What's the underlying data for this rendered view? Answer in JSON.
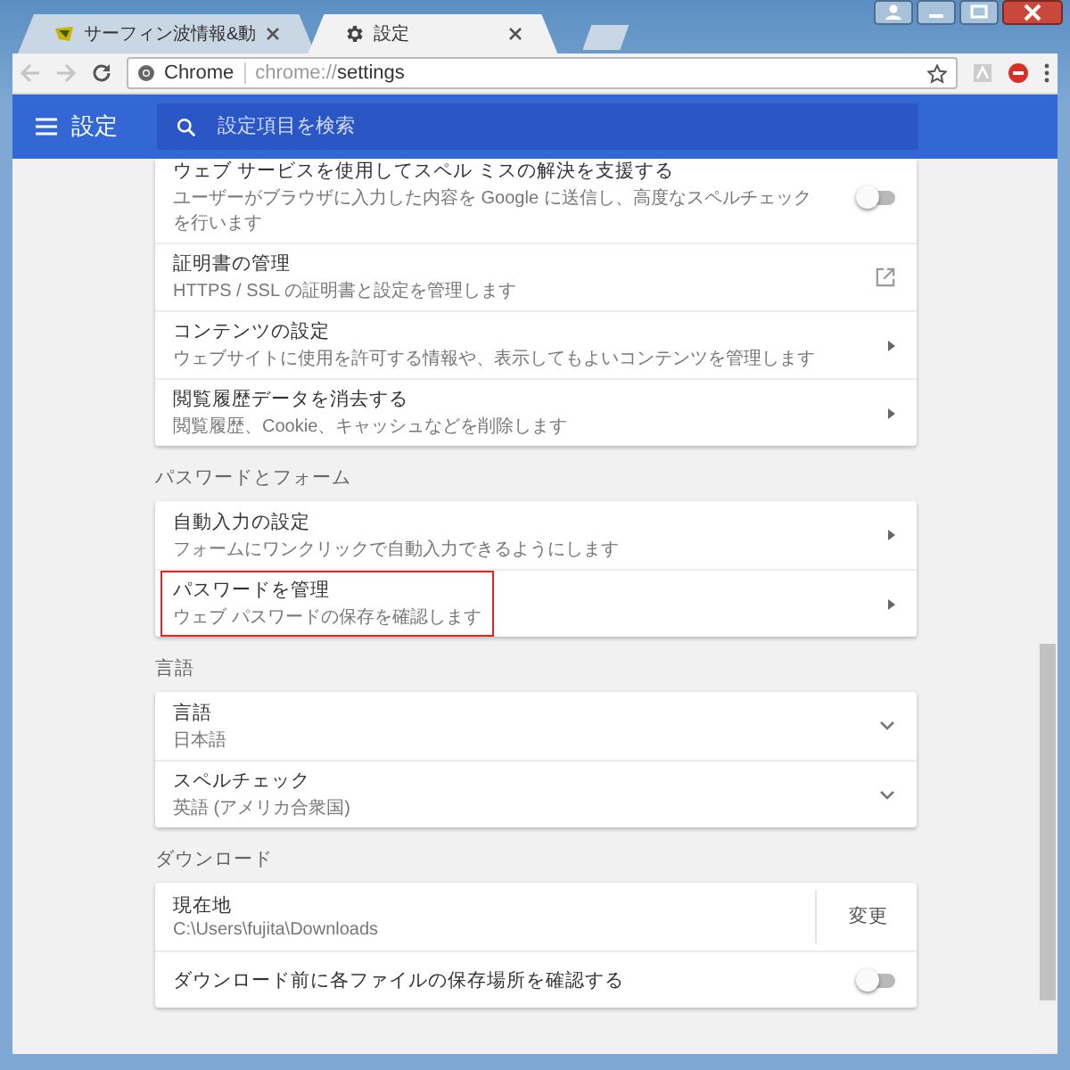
{
  "tabs": [
    {
      "title": "サーフィン波情報&動",
      "kind": "site",
      "selected": false
    },
    {
      "title": "設定",
      "kind": "settings",
      "selected": true
    }
  ],
  "toolbar": {
    "back": {
      "disabled": true
    },
    "forward": {
      "disabled": true
    },
    "omnibox": {
      "site_label": "Chrome",
      "url_scheme": "chrome://",
      "url_path": "settings",
      "bookmarked": false
    }
  },
  "header": {
    "title": "設定",
    "search": {
      "placeholder": "設定項目を検索"
    }
  },
  "sections": [
    {
      "items": [
        {
          "title": "ウェブ サービスを使用してスペル ミスの解決を支援する",
          "subtitle": "ユーザーがブラウザに入力した内容を Google に送信し、高度なスペルチェックを行います",
          "kind": "toggle",
          "on": false,
          "highlighted": false
        },
        {
          "title": "証明書の管理",
          "subtitle": "HTTPS / SSL の証明書と設定を管理します",
          "kind": "external",
          "highlighted": false
        },
        {
          "title": "コンテンツの設定",
          "subtitle": "ウェブサイトに使用を許可する情報や、表示してもよいコンテンツを管理します",
          "kind": "arrow",
          "highlighted": false
        },
        {
          "title": "閲覧履歴データを消去する",
          "subtitle": "閲覧履歴、Cookie、キャッシュなどを削除します",
          "kind": "arrow",
          "highlighted": false
        }
      ]
    },
    {
      "heading": "パスワードとフォーム",
      "items": [
        {
          "title": "自動入力の設定",
          "subtitle": "フォームにワンクリックで自動入力できるようにします",
          "kind": "arrow",
          "highlighted": false
        },
        {
          "title": "パスワードを管理",
          "subtitle": "ウェブ パスワードの保存を確認します",
          "kind": "arrow",
          "highlighted": true
        }
      ]
    },
    {
      "heading": "言語",
      "items": [
        {
          "title": "言語",
          "subtitle": "日本語",
          "kind": "dropdown",
          "highlighted": false
        },
        {
          "title": "スペルチェック",
          "subtitle": "英語 (アメリカ合衆国)",
          "kind": "dropdown",
          "highlighted": false
        }
      ]
    },
    {
      "heading": "ダウンロード",
      "items": [
        {
          "title": "現在地",
          "subtitle": "C:\\Users\\fujita\\Downloads",
          "kind": "action",
          "action": "変更",
          "highlighted": false
        },
        {
          "title": "ダウンロード前に各ファイルの保存場所を確認する",
          "kind": "toggle",
          "on": false,
          "highlighted": false
        }
      ]
    }
  ]
}
